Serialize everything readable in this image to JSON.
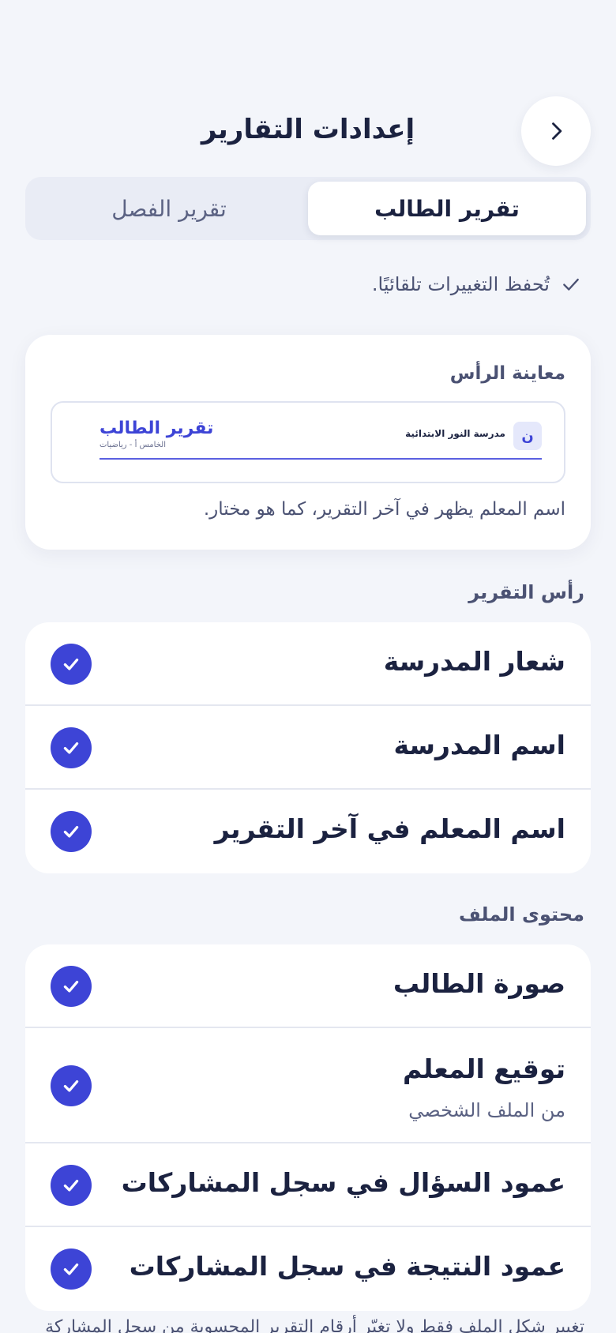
{
  "header": {
    "title": "إعدادات التقارير",
    "back_icon": "chevron-right-icon"
  },
  "tabs": [
    {
      "label": "تقرير الطالب",
      "selected": true
    },
    {
      "label": "تقرير الفصل",
      "selected": false
    }
  ],
  "autosave": {
    "text": "تُحفظ التغييرات تلقائيًا."
  },
  "preview": {
    "heading": "معاينة الرأس",
    "logo_letter": "ن",
    "school_name": "مدرسة النور الابتدائية",
    "report_title": "تقرير الطالب",
    "report_subtitle": "الخامس أ - رياضيات",
    "note": "اسم المعلم يظهر في آخر التقرير، كما هو مختار."
  },
  "header_section": {
    "label": "رأس التقرير",
    "items": [
      {
        "label": "شعار المدرسة",
        "checked": true
      },
      {
        "label": "اسم المدرسة",
        "checked": true
      },
      {
        "label": "اسم المعلم في آخر التقرير",
        "checked": true
      }
    ]
  },
  "content_section": {
    "label": "محتوى الملف",
    "items": [
      {
        "label": "صورة الطالب",
        "checked": true
      },
      {
        "label": "توقيع المعلم",
        "sublabel": "من الملف الشخصي",
        "checked": true
      },
      {
        "label": "عمود السؤال في سجل المشاركات",
        "checked": true
      },
      {
        "label": "عمود النتيجة في سجل المشاركات",
        "checked": true
      }
    ]
  },
  "footer_note": "تغيير شكل الملف فقط ولا تغيّر أرقام التقرير المحسوبة من سجل المشاركة",
  "colors": {
    "accent": "#3d44d6",
    "background": "#f3f5fa",
    "card": "#ffffff"
  }
}
